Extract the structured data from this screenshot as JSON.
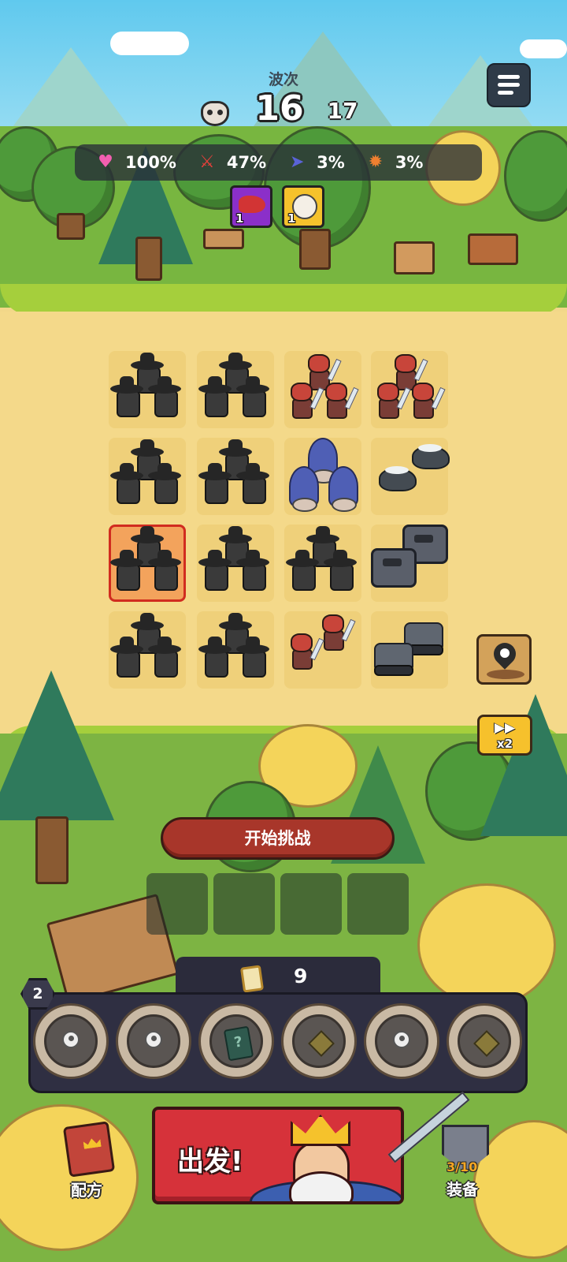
{
  "hud": {
    "wave_label": "波次",
    "wave_current": "16",
    "wave_next": "17",
    "wave_icon": "owl-icon",
    "menu_icon": "hamburger-menu-icon"
  },
  "stats": [
    {
      "icon": "heart-icon",
      "value": "100%",
      "color": "#f25fb0"
    },
    {
      "icon": "sword-icon",
      "value": "47%",
      "color": "#e8403a"
    },
    {
      "icon": "boot-icon",
      "value": "3%",
      "color": "#5a63d8"
    },
    {
      "icon": "crit-icon",
      "value": "3%",
      "color": "#f08030"
    }
  ],
  "buffs": [
    {
      "icon": "blood-splash-icon",
      "count": "1",
      "color": "#8b2fc9"
    },
    {
      "icon": "rage-head-icon",
      "count": "1",
      "color": "#f5c22c"
    }
  ],
  "grid": {
    "rows": [
      [
        "cowboy-squad",
        "cowboy-squad",
        "warrior-squad",
        "warrior-squad"
      ],
      [
        "cowboy-squad",
        "cowboy-squad",
        "ghost-squad",
        "beast-squad"
      ],
      [
        "cowboy-squad",
        "cowboy-squad",
        "cowboy-squad",
        "mech-squad"
      ],
      [
        "cowboy-squad",
        "cowboy-squad",
        "warrior-pair",
        "tank-pair"
      ]
    ],
    "selected_cell": "row-3-col-1"
  },
  "side_buttons": {
    "skull_icon": "skull-location-icon",
    "speed_icon": "fast-forward-icon",
    "speed_label": "x2"
  },
  "challenge_button": "开始挑战",
  "hand": {
    "level": "2",
    "coin_icon": "scroll-coin-icon",
    "coins": "9",
    "slots": [
      "person-icon",
      "person-icon",
      "mystery-card-icon",
      "diamond-icon",
      "person-icon",
      "diamond-icon"
    ]
  },
  "bottom": {
    "go_label": "出发!",
    "recipe_label": "配方",
    "equip_label": "装备",
    "equip_count": "3/10"
  },
  "colors": {
    "go_button": "#d6323a",
    "challenge_button": "#a8362a",
    "speed_button": "#f6c12c",
    "panel": "#2f2f42"
  }
}
